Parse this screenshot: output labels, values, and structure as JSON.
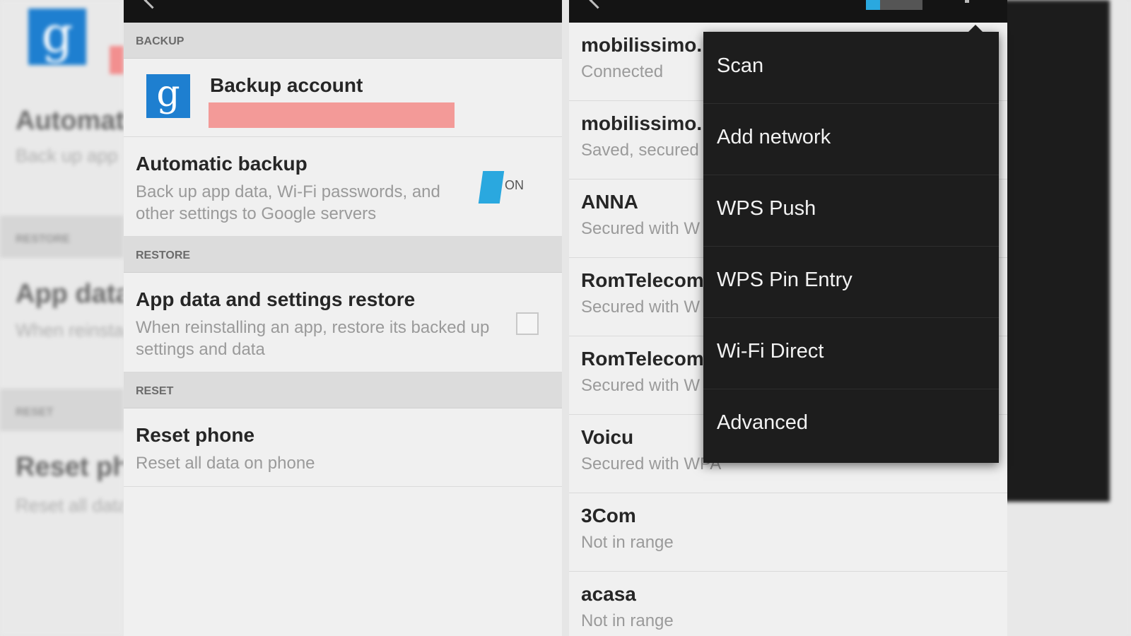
{
  "left_screen": {
    "sections": {
      "backup": "BACKUP",
      "restore": "RESTORE",
      "reset": "RESET"
    },
    "backup_account": {
      "icon": "google-g-icon",
      "title": "Backup account",
      "value_redacted_color": "#f39a98"
    },
    "automatic_backup": {
      "title": "Automatic backup",
      "description": "Back up app data, Wi-Fi passwords, and other settings to Google servers",
      "toggle_label": "ON"
    },
    "app_restore": {
      "title": "App data and settings restore",
      "description": "When reinstalling an app, restore its backed up settings and data"
    },
    "reset_phone": {
      "title": "Reset phone",
      "description": "Reset all data on phone"
    }
  },
  "right_screen": {
    "networks": [
      {
        "name": "mobilissimo.ı",
        "status": "Connected"
      },
      {
        "name": "mobilissimo.r",
        "status": "Saved, secured"
      },
      {
        "name": "ANNA",
        "status": "Secured with W"
      },
      {
        "name": "RomTelecom-",
        "status": "Secured with W"
      },
      {
        "name": "RomTelecom-",
        "status": "Secured with W"
      },
      {
        "name": "Voicu",
        "status": "Secured with WPA"
      },
      {
        "name": "3Com",
        "status": "Not in range"
      },
      {
        "name": "acasa",
        "status": "Not in range"
      }
    ],
    "overflow_menu": [
      "Scan",
      "Add network",
      "WPS Push",
      "WPS Pin Entry",
      "Wi-Fi Direct",
      "Advanced"
    ]
  },
  "colors": {
    "accent": "#2aa8df",
    "google_blue": "#1e7fd0",
    "menu_bg": "#1d1d1d"
  }
}
